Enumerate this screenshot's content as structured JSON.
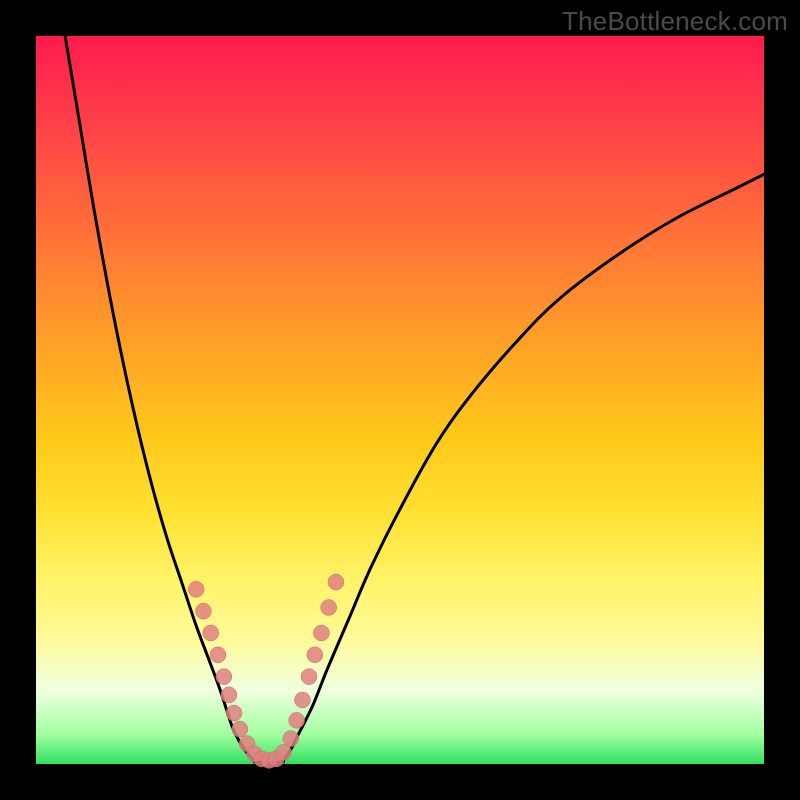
{
  "watermark": "TheBottleneck.com",
  "colors": {
    "frame_border": "#000000",
    "curve_stroke": "#000000",
    "marker_fill": "#e08080",
    "gradient_top": "#ff1a4d",
    "gradient_bottom": "#30e060"
  },
  "chart_data": {
    "type": "line",
    "title": "",
    "xlabel": "",
    "ylabel": "",
    "xlim": [
      0,
      100
    ],
    "ylim": [
      0,
      100
    ],
    "note": "Axes have no tick labels in the source image; values are normalized 0–100 estimates read from pixel positions. y=0 is the bottom (green) edge, y=100 is the top (red) edge.",
    "series": [
      {
        "name": "left-branch",
        "x": [
          4,
          6,
          8,
          10,
          12,
          14,
          16,
          18,
          20,
          22,
          23.5,
          25,
          26,
          27,
          28,
          29,
          30
        ],
        "y": [
          100,
          88,
          76,
          65,
          55,
          46,
          38,
          31,
          25,
          19,
          15,
          11,
          8,
          5,
          3,
          1.5,
          0.5
        ]
      },
      {
        "name": "bottom-flat",
        "x": [
          30,
          31,
          32,
          33,
          34
        ],
        "y": [
          0.3,
          0.2,
          0.2,
          0.2,
          0.3
        ]
      },
      {
        "name": "right-branch",
        "x": [
          34,
          35,
          36,
          38,
          40,
          43,
          46,
          50,
          55,
          60,
          66,
          72,
          80,
          88,
          96,
          100
        ],
        "y": [
          0.5,
          2,
          4,
          8,
          13,
          20,
          27,
          35,
          44,
          51,
          58,
          64,
          70,
          75,
          79,
          81
        ]
      }
    ],
    "markers": {
      "name": "accent-dots",
      "color": "#e08080",
      "points": [
        {
          "x": 22.0,
          "y": 24.0
        },
        {
          "x": 23.0,
          "y": 21.0
        },
        {
          "x": 24.0,
          "y": 18.0
        },
        {
          "x": 25.0,
          "y": 15.0
        },
        {
          "x": 25.8,
          "y": 12.0
        },
        {
          "x": 26.5,
          "y": 9.5
        },
        {
          "x": 27.2,
          "y": 7.0
        },
        {
          "x": 28.0,
          "y": 4.8
        },
        {
          "x": 29.0,
          "y": 2.8
        },
        {
          "x": 30.0,
          "y": 1.4
        },
        {
          "x": 31.0,
          "y": 0.7
        },
        {
          "x": 32.0,
          "y": 0.5
        },
        {
          "x": 33.0,
          "y": 0.7
        },
        {
          "x": 34.0,
          "y": 1.6
        },
        {
          "x": 35.0,
          "y": 3.5
        },
        {
          "x": 35.8,
          "y": 6.0
        },
        {
          "x": 36.6,
          "y": 8.8
        },
        {
          "x": 37.5,
          "y": 12.0
        },
        {
          "x": 38.3,
          "y": 15.0
        },
        {
          "x": 39.2,
          "y": 18.0
        },
        {
          "x": 40.2,
          "y": 21.5
        },
        {
          "x": 41.2,
          "y": 25.0
        }
      ]
    }
  }
}
